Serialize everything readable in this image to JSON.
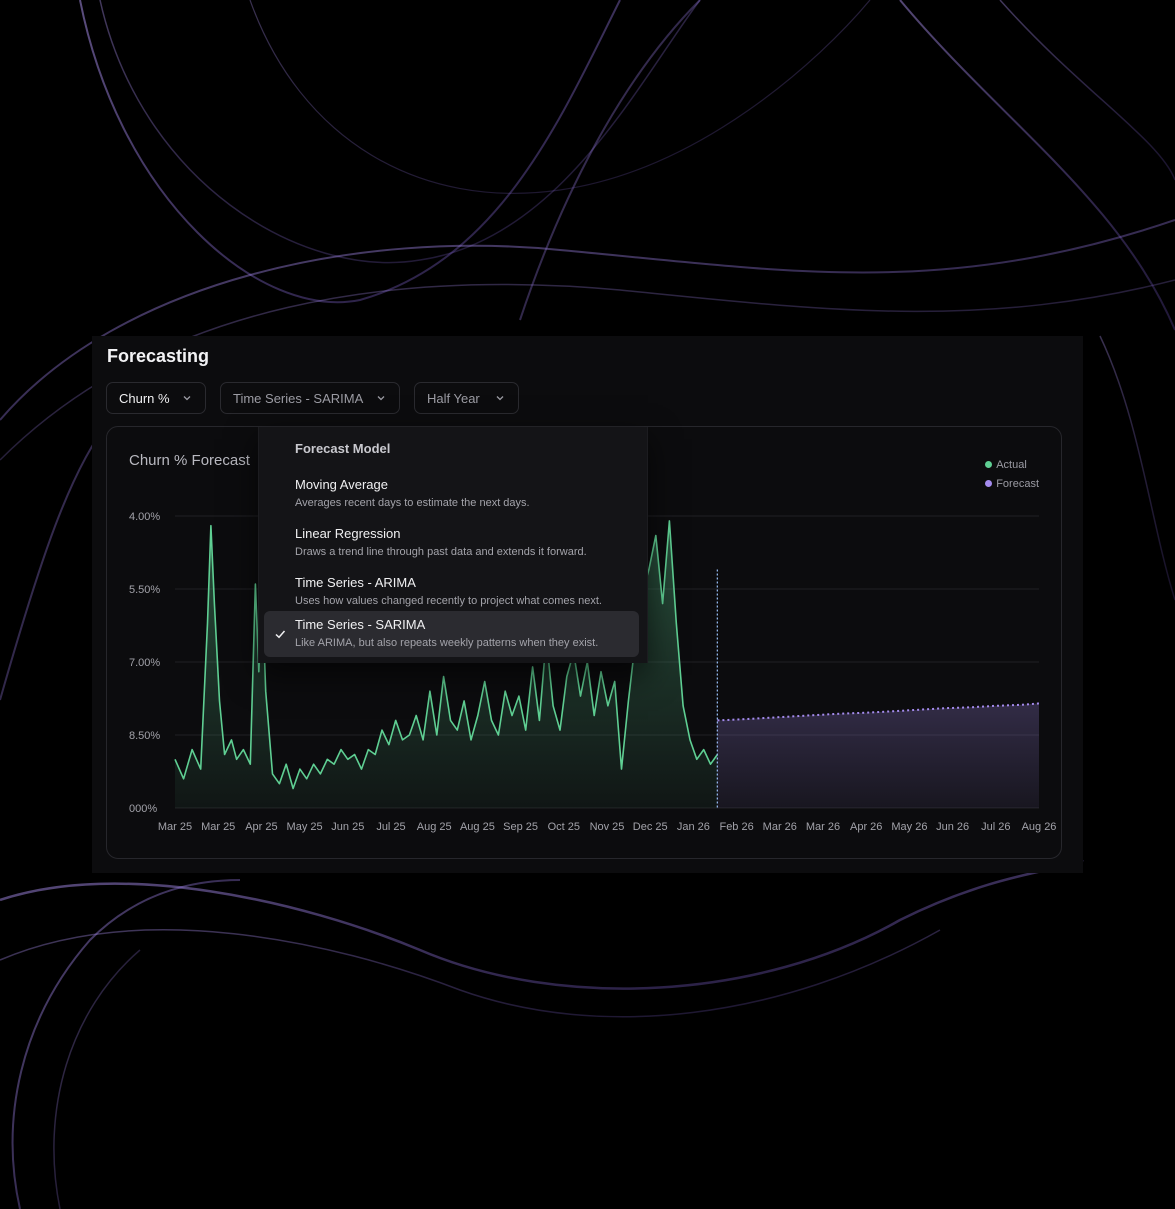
{
  "panel": {
    "title": "Forecasting"
  },
  "filters": {
    "metric": "Churn %",
    "model": "Time Series - SARIMA",
    "range": "Half Year"
  },
  "card": {
    "title": "Churn % Forecast"
  },
  "legend": [
    {
      "label": "Actual",
      "color": "#5fcf93"
    },
    {
      "label": "Forecast",
      "color": "#a48bed"
    }
  ],
  "dropdown": {
    "header": "Forecast Model",
    "items": [
      {
        "label": "Moving Average",
        "description": "Averages recent days to estimate the next days.",
        "selected": false
      },
      {
        "label": "Linear Regression",
        "description": "Draws a trend line through past data and extends it forward.",
        "selected": false
      },
      {
        "label": "Time Series - ARIMA",
        "description": "Uses how values changed recently to project what comes next.",
        "selected": false
      },
      {
        "label": "Time Series - SARIMA",
        "description": "Like ARIMA, but also repeats weekly patterns when they exist.",
        "selected": true
      }
    ]
  },
  "colors": {
    "actual": "#5fcf93",
    "forecast": "#a48bed",
    "background": "#000000",
    "panel": "#0c0c0e"
  },
  "icons": {
    "chevron": "chevron-down-icon",
    "check": "check-icon"
  },
  "chart_data": {
    "type": "area",
    "title": "Churn % Forecast",
    "y_tick_labels": [
      "4.00%",
      "5.50%",
      "7.00%",
      "8.50%",
      "000%"
    ],
    "x_tick_labels": [
      "Mar 25",
      "Mar 25",
      "Apr 25",
      "May 25",
      "Jun 25",
      "Jul 25",
      "Aug 25",
      "Aug 25",
      "Sep 25",
      "Oct 25",
      "Nov 25",
      "Dec 25",
      "Jan 26",
      "Feb 26",
      "Mar 26",
      "Mar 26",
      "Apr 26",
      "May 26",
      "Jun 26",
      "Jul 26",
      "Aug 26"
    ],
    "ylim": [
      0,
      6
    ],
    "grid": true,
    "legend_position": "top-right",
    "series": [
      {
        "name": "Actual",
        "period": "Mar 25 - Mar 26",
        "points": [
          [
            0,
            1.0
          ],
          [
            5,
            0.6
          ],
          [
            10,
            1.2
          ],
          [
            15,
            0.8
          ],
          [
            19,
            3.8
          ],
          [
            21,
            5.8
          ],
          [
            23,
            4.2
          ],
          [
            26,
            2.2
          ],
          [
            29,
            1.1
          ],
          [
            33,
            1.4
          ],
          [
            36,
            1.0
          ],
          [
            40,
            1.2
          ],
          [
            44,
            0.9
          ],
          [
            47,
            4.6
          ],
          [
            49,
            2.8
          ],
          [
            51,
            4.4
          ],
          [
            53,
            2.4
          ],
          [
            57,
            0.7
          ],
          [
            61,
            0.5
          ],
          [
            65,
            0.9
          ],
          [
            69,
            0.4
          ],
          [
            73,
            0.8
          ],
          [
            77,
            0.6
          ],
          [
            81,
            0.9
          ],
          [
            85,
            0.7
          ],
          [
            89,
            1.0
          ],
          [
            93,
            0.9
          ],
          [
            97,
            1.2
          ],
          [
            101,
            1.0
          ],
          [
            105,
            1.1
          ],
          [
            109,
            0.8
          ],
          [
            113,
            1.2
          ],
          [
            117,
            1.1
          ],
          [
            121,
            1.6
          ],
          [
            125,
            1.3
          ],
          [
            129,
            1.8
          ],
          [
            133,
            1.4
          ],
          [
            137,
            1.5
          ],
          [
            141,
            1.9
          ],
          [
            145,
            1.4
          ],
          [
            149,
            2.4
          ],
          [
            153,
            1.5
          ],
          [
            157,
            2.7
          ],
          [
            161,
            1.8
          ],
          [
            165,
            1.6
          ],
          [
            169,
            2.2
          ],
          [
            173,
            1.4
          ],
          [
            177,
            1.9
          ],
          [
            181,
            2.6
          ],
          [
            185,
            1.8
          ],
          [
            189,
            1.5
          ],
          [
            193,
            2.4
          ],
          [
            197,
            1.9
          ],
          [
            201,
            2.3
          ],
          [
            205,
            1.6
          ],
          [
            209,
            2.9
          ],
          [
            213,
            1.8
          ],
          [
            217,
            3.5
          ],
          [
            221,
            2.1
          ],
          [
            225,
            1.6
          ],
          [
            229,
            2.7
          ],
          [
            233,
            3.2
          ],
          [
            237,
            2.3
          ],
          [
            241,
            3.0
          ],
          [
            245,
            1.9
          ],
          [
            249,
            2.8
          ],
          [
            253,
            2.1
          ],
          [
            257,
            2.6
          ],
          [
            261,
            0.8
          ],
          [
            265,
            2.2
          ],
          [
            269,
            3.4
          ],
          [
            273,
            4.4
          ],
          [
            277,
            4.9
          ],
          [
            281,
            5.6
          ],
          [
            285,
            4.2
          ],
          [
            289,
            5.9
          ],
          [
            293,
            3.8
          ],
          [
            297,
            2.1
          ],
          [
            301,
            1.4
          ],
          [
            305,
            1.0
          ],
          [
            309,
            1.2
          ],
          [
            313,
            0.9
          ],
          [
            317,
            1.1
          ]
        ]
      },
      {
        "name": "Forecast",
        "period": "Mar 26 - Aug 26",
        "points": [
          [
            317,
            1.8
          ],
          [
            330,
            1.82
          ],
          [
            345,
            1.85
          ],
          [
            360,
            1.88
          ],
          [
            375,
            1.91
          ],
          [
            390,
            1.94
          ],
          [
            405,
            1.96
          ],
          [
            420,
            1.99
          ],
          [
            435,
            2.02
          ],
          [
            450,
            2.05
          ],
          [
            465,
            2.07
          ],
          [
            480,
            2.1
          ],
          [
            495,
            2.12
          ],
          [
            505,
            2.15
          ]
        ]
      }
    ]
  }
}
